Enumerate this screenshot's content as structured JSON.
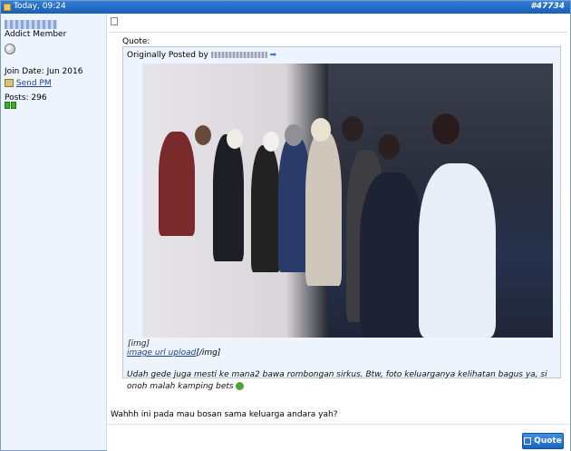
{
  "header": {
    "date": "Today, 09:24",
    "post_number": "#47734"
  },
  "user": {
    "title": "Addict Member",
    "join_date": "Join Date: Jun 2016",
    "send_pm": "Send PM",
    "posts": "Posts: 296"
  },
  "quote": {
    "label": "Quote:",
    "originally_posted_by": "Originally Posted by",
    "img_tag": "[img]",
    "link_text": "image url upload",
    "img_close": "[/img]",
    "text": "Udah gede juga mesti ke mana2 bawa rombongan sirkus. Btw, foto keluarganya kelihatan bagus ya, si onoh malah kamping bets"
  },
  "reply": {
    "text": "Wahhh ini pada mau bosan sama keluarga andara yah?"
  },
  "buttons": {
    "quote": "Quote"
  },
  "colors": {
    "header": "#1a5db6",
    "sidebar": "#eef4fd",
    "link": "#1c3e9c"
  }
}
